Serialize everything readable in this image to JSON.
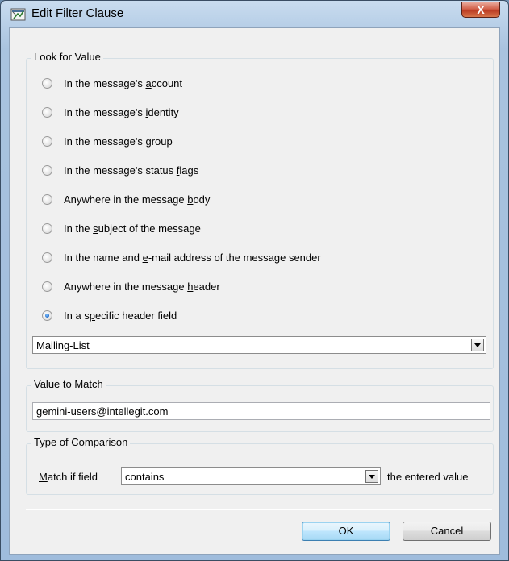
{
  "window": {
    "title": "Edit Filter Clause",
    "close_label": "X"
  },
  "look_for_value": {
    "legend": "Look for Value",
    "options": [
      {
        "pre": "In the message's ",
        "key": "a",
        "post": "ccount",
        "checked": false
      },
      {
        "pre": "In the message's ",
        "key": "i",
        "post": "dentity",
        "checked": false
      },
      {
        "pre": "In the message's ",
        "key": "g",
        "post": "roup",
        "checked": false
      },
      {
        "pre": "In the message's status ",
        "key": "f",
        "post": "lags",
        "checked": false
      },
      {
        "pre": "Anywhere in the message ",
        "key": "b",
        "post": "ody",
        "checked": false
      },
      {
        "pre": "In the ",
        "key": "s",
        "post": "ubject of the message",
        "checked": false
      },
      {
        "pre": "In the name and ",
        "key": "e",
        "post": "-mail address of the message sender",
        "checked": false
      },
      {
        "pre": "Anywhere in the message ",
        "key": "h",
        "post": "eader",
        "checked": false
      },
      {
        "pre": "In a s",
        "key": "p",
        "post": "ecific header field",
        "checked": true
      }
    ],
    "header_field_value": "Mailing-List"
  },
  "value_to_match": {
    "legend": "Value to Match",
    "value": "gemini-users@intellegit.com"
  },
  "comparison": {
    "legend": "Type of Comparison",
    "label_key": "M",
    "label_rest": "atch if field",
    "selected": "contains",
    "suffix": "the entered value"
  },
  "buttons": {
    "ok": "OK",
    "cancel": "Cancel"
  }
}
